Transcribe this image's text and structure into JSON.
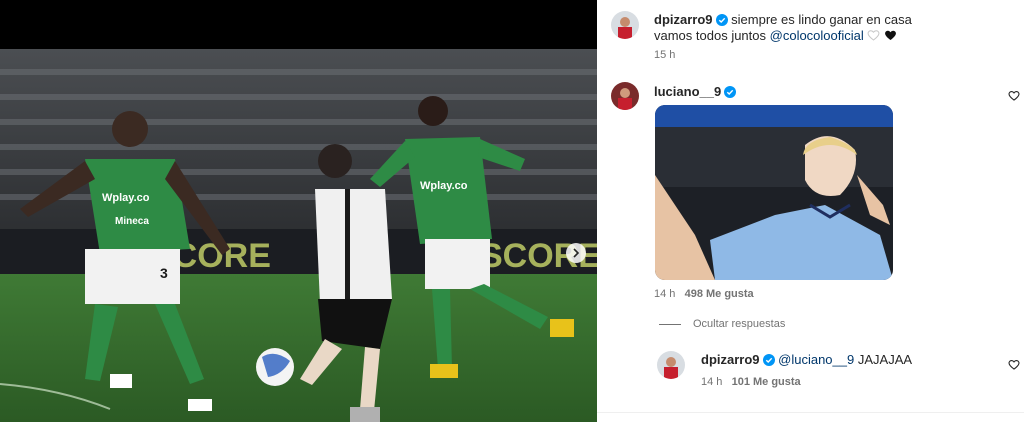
{
  "post": {
    "author": "dpizarro9",
    "caption_line1": "siempre es lindo ganar en casa",
    "caption_line2_prefix": "vamos todos juntos",
    "caption_mention": "@colocolooficial",
    "time": "15 h",
    "jersey_brand": "Wplay.co",
    "jersey_sponsor": "Mineca",
    "number": "3"
  },
  "comments": [
    {
      "user": "luciano__9",
      "time": "14 h",
      "likes": "498 Me gusta"
    }
  ],
  "hide_replies": "Ocultar respuestas",
  "reply": {
    "user": "dpizarro9",
    "mention": "@luciano__9",
    "text": "JAJAJAA",
    "time": "14 h",
    "likes": "101 Me gusta"
  },
  "colors": {
    "verified": "#0095f6",
    "mention": "#00376b",
    "meta": "#737373"
  },
  "icons": [
    "verified-icon",
    "heart-icon",
    "black-heart-icon",
    "white-heart-icon",
    "chevron-right-icon"
  ]
}
